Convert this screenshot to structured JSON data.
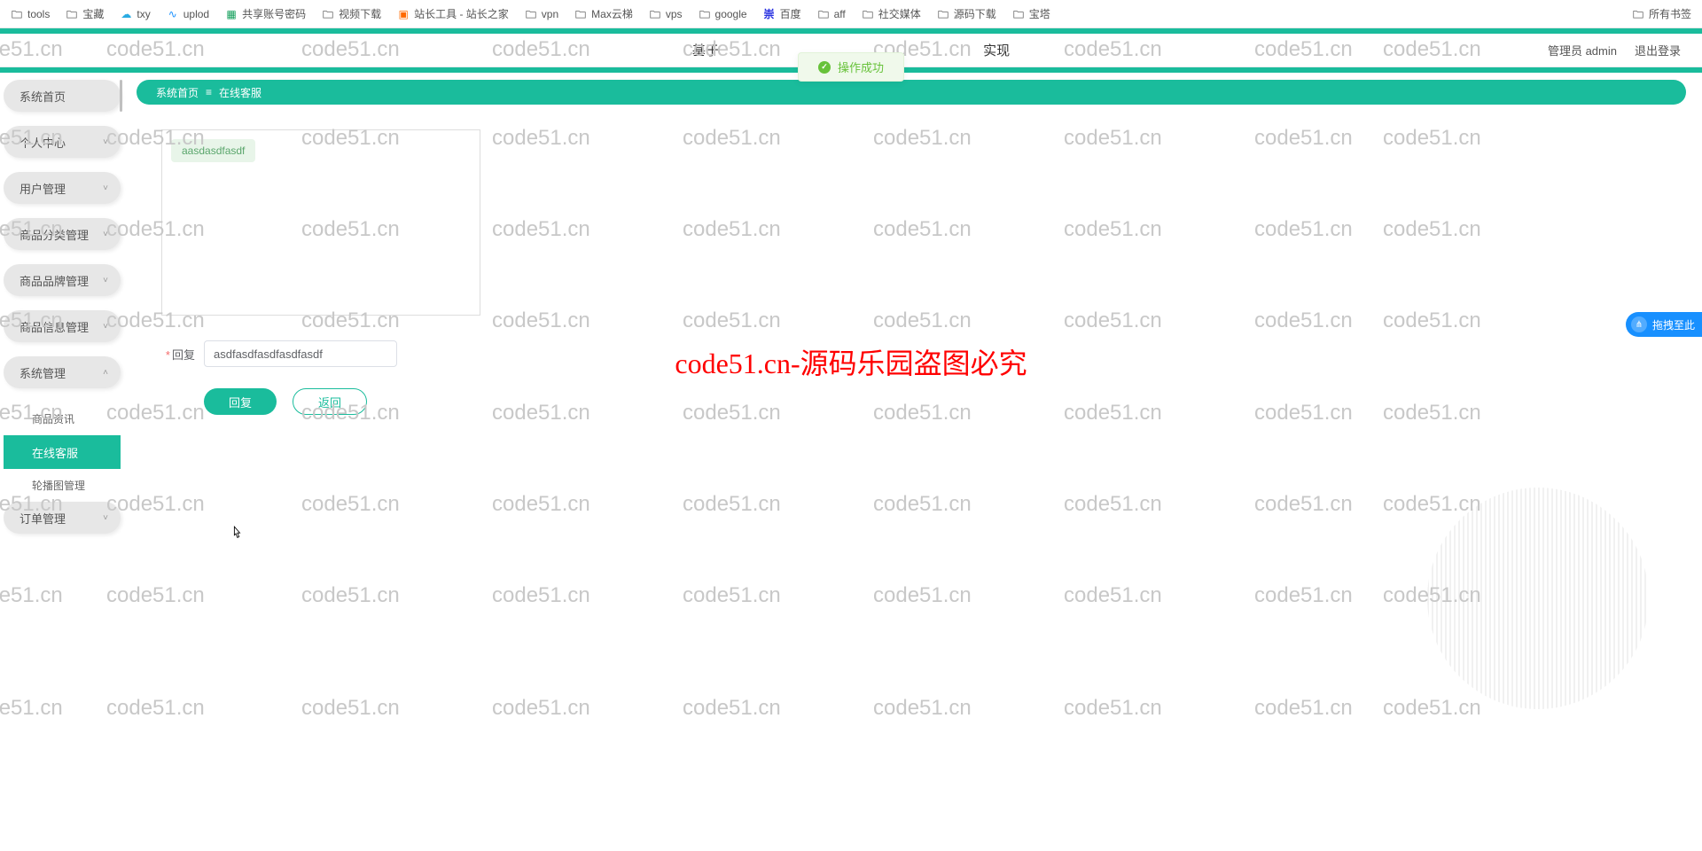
{
  "bookmarks": {
    "left": [
      {
        "icon": "folder",
        "label": "tools"
      },
      {
        "icon": "folder",
        "label": "宝藏"
      },
      {
        "icon": "cloud",
        "label": "txy"
      },
      {
        "icon": "script",
        "label": "uplod"
      },
      {
        "icon": "sheet",
        "label": "共享账号密码"
      },
      {
        "icon": "folder",
        "label": "视频下载"
      },
      {
        "icon": "sitez",
        "label": "站长工具 - 站长之家"
      },
      {
        "icon": "folder",
        "label": "vpn"
      },
      {
        "icon": "folder",
        "label": "Max云梯"
      },
      {
        "icon": "folder",
        "label": "vps"
      },
      {
        "icon": "folder",
        "label": "google"
      },
      {
        "icon": "baidu",
        "label": "百度"
      },
      {
        "icon": "folder",
        "label": "aff"
      },
      {
        "icon": "folder",
        "label": "社交媒体"
      },
      {
        "icon": "folder",
        "label": "源码下载"
      },
      {
        "icon": "folder",
        "label": "宝塔"
      }
    ],
    "right": [
      {
        "icon": "folder",
        "label": "所有书签"
      }
    ]
  },
  "header": {
    "title_prefix": "基于",
    "title_suffix": "实现",
    "user_label": "管理员 admin",
    "logout": "退出登录"
  },
  "toast": {
    "text": "操作成功"
  },
  "sidebar": {
    "items": [
      {
        "label": "系统首页",
        "expand": false
      },
      {
        "label": "个人中心",
        "expand": true
      },
      {
        "label": "用户管理",
        "expand": true
      },
      {
        "label": "商品分类管理",
        "expand": true
      },
      {
        "label": "商品品牌管理",
        "expand": true
      },
      {
        "label": "商品信息管理",
        "expand": true
      },
      {
        "label": "系统管理",
        "expand": true,
        "open": true,
        "subs": [
          {
            "label": "商品资讯"
          },
          {
            "label": "在线客服",
            "active": true
          },
          {
            "label": "轮播图管理"
          }
        ]
      },
      {
        "label": "订单管理",
        "expand": true
      }
    ]
  },
  "breadcrumb": {
    "home": "系统首页",
    "sep": "≡",
    "current": "在线客服"
  },
  "chat": {
    "message": "aasdasdfasdf"
  },
  "form": {
    "reply_label": "回复",
    "reply_value": "asdfasdfasdfasdfasdf",
    "submit": "回复",
    "back": "返回"
  },
  "float_badge": "拖拽至此",
  "watermark": "code51.cn",
  "watermark_red": "code51.cn-源码乐园盗图必究"
}
